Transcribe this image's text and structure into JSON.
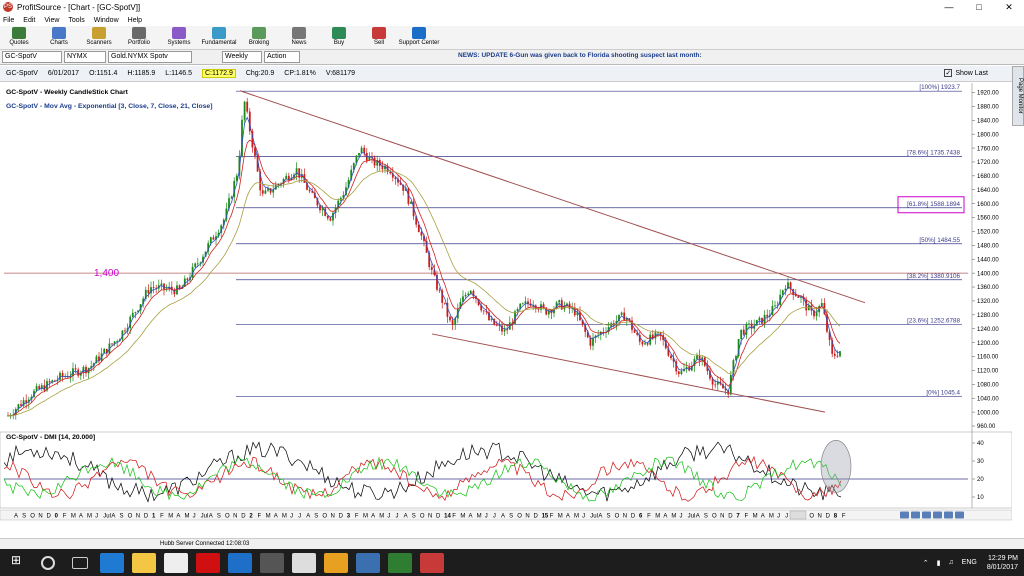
{
  "window": {
    "title": "ProfitSource - [Chart - [GC-SpotV]]",
    "app_icon_label": "PS"
  },
  "menu": [
    "File",
    "Edit",
    "View",
    "Tools",
    "Window",
    "Help"
  ],
  "toolbar": [
    "Quotes",
    "Charts",
    "Scanners",
    "Portfolio",
    "Systems",
    "Fundamental",
    "Broking",
    "News",
    "Buy",
    "Sell",
    "Support Center"
  ],
  "toolbar_colors": [
    "#3a7d3a",
    "#4a78c8",
    "#c8a032",
    "#6a6a6a",
    "#8a5ac8",
    "#3a9ac8",
    "#5a9a5a",
    "#777777",
    "#2e8b57",
    "#c83a3a",
    "#1a6ec8"
  ],
  "symbol_bar": {
    "symbol": "GC-SpotV",
    "exchange": "NYMX",
    "description": "Gold.NYMX Spotv",
    "period": "Weekly",
    "action": "Action"
  },
  "news_ticker": "NEWS: UPDATE 6-Gun was given back to Florida shooting suspect last month:",
  "quote": {
    "symbol": "GC-SpotV",
    "date": "6/01/2017",
    "open": "O:1151.4",
    "high": "H:1185.9",
    "low": "L:1146.5",
    "close": "C:1172.9",
    "change": "Chg:20.9",
    "change_pct": "CP:1.81%",
    "volume": "V:681179"
  },
  "show_last": "Show Last",
  "side_tab": "Page Monitor",
  "chart_data": [
    {
      "type": "candlestick",
      "title": "GC-SpotV - Weekly CandleStick Chart",
      "overlay_label": "GC-SpotV - Mov Avg - Exponential [3, Close, 7, Close, 21, Close]",
      "ylim": [
        960,
        1930
      ],
      "y_ticks": [
        960,
        1000,
        1040,
        1080,
        1120,
        1160,
        1200,
        1240,
        1280,
        1320,
        1360,
        1400,
        1440,
        1480,
        1520,
        1560,
        1600,
        1640,
        1680,
        1720,
        1760,
        1800,
        1840,
        1880,
        1920
      ],
      "fib_levels": [
        {
          "label": "[100%] 1923.7",
          "value": 1923.7
        },
        {
          "label": "[78.6%] 1735.7438",
          "value": 1735.7438
        },
        {
          "label": "[61.8%] 1588.1894",
          "value": 1588.1894
        },
        {
          "label": "[50%] 1484.55",
          "value": 1484.55
        },
        {
          "label": "[38.2%] 1380.9106",
          "value": 1380.9106
        },
        {
          "label": "[23.6%] 1252.6788",
          "value": 1252.6788
        },
        {
          "label": "[0%] 1045.4",
          "value": 1045.4
        }
      ],
      "annotation": "1,400",
      "colors": {
        "up": "#1a8a1a",
        "down": "#c81e1e",
        "fib": "#3a3a8a",
        "trend": "#a05050",
        "highlight": "#cc00cc"
      }
    },
    {
      "type": "line",
      "title": "GC-SpotV - DMI [14, 20.000]",
      "ylim": [
        5,
        45
      ],
      "y_ticks": [
        10,
        20,
        30,
        40
      ],
      "series": [
        {
          "color": "#000000"
        },
        {
          "color": "#d01010"
        },
        {
          "color": "#10c010"
        }
      ]
    }
  ],
  "x_axis_labels": [
    "A",
    "S",
    "O",
    "N",
    "D",
    "0",
    "F",
    "M",
    "A",
    "M",
    "J",
    "Jul",
    "A",
    "S",
    "O",
    "N",
    "D",
    "1",
    "F",
    "M",
    "A",
    "M",
    "J",
    "Jul",
    "A",
    "S",
    "O",
    "N",
    "D",
    "2",
    "F",
    "M",
    "A",
    "M",
    "J",
    "J",
    "A",
    "S",
    "O",
    "N",
    "D",
    "3",
    "F",
    "M",
    "A",
    "M",
    "J",
    "J",
    "A",
    "S",
    "O",
    "N",
    "D",
    "14",
    "F",
    "M",
    "A",
    "M",
    "J",
    "J",
    "A",
    "S",
    "O",
    "N",
    "D",
    "15",
    "F",
    "M",
    "A",
    "M",
    "J",
    "Jul",
    "A",
    "S",
    "O",
    "N",
    "D",
    "6",
    "F",
    "M",
    "A",
    "M",
    "J",
    "Jul",
    "A",
    "S",
    "O",
    "N",
    "D",
    "7",
    "F",
    "M",
    "A",
    "M",
    "J",
    "J",
    "A",
    "S",
    "O",
    "N",
    "D",
    "8",
    "F"
  ],
  "status_bar": "Hubb Server Connected 12:08:03",
  "taskbar": {
    "lang": "ENG",
    "time": "12:29 PM",
    "date": "8/01/2017"
  }
}
